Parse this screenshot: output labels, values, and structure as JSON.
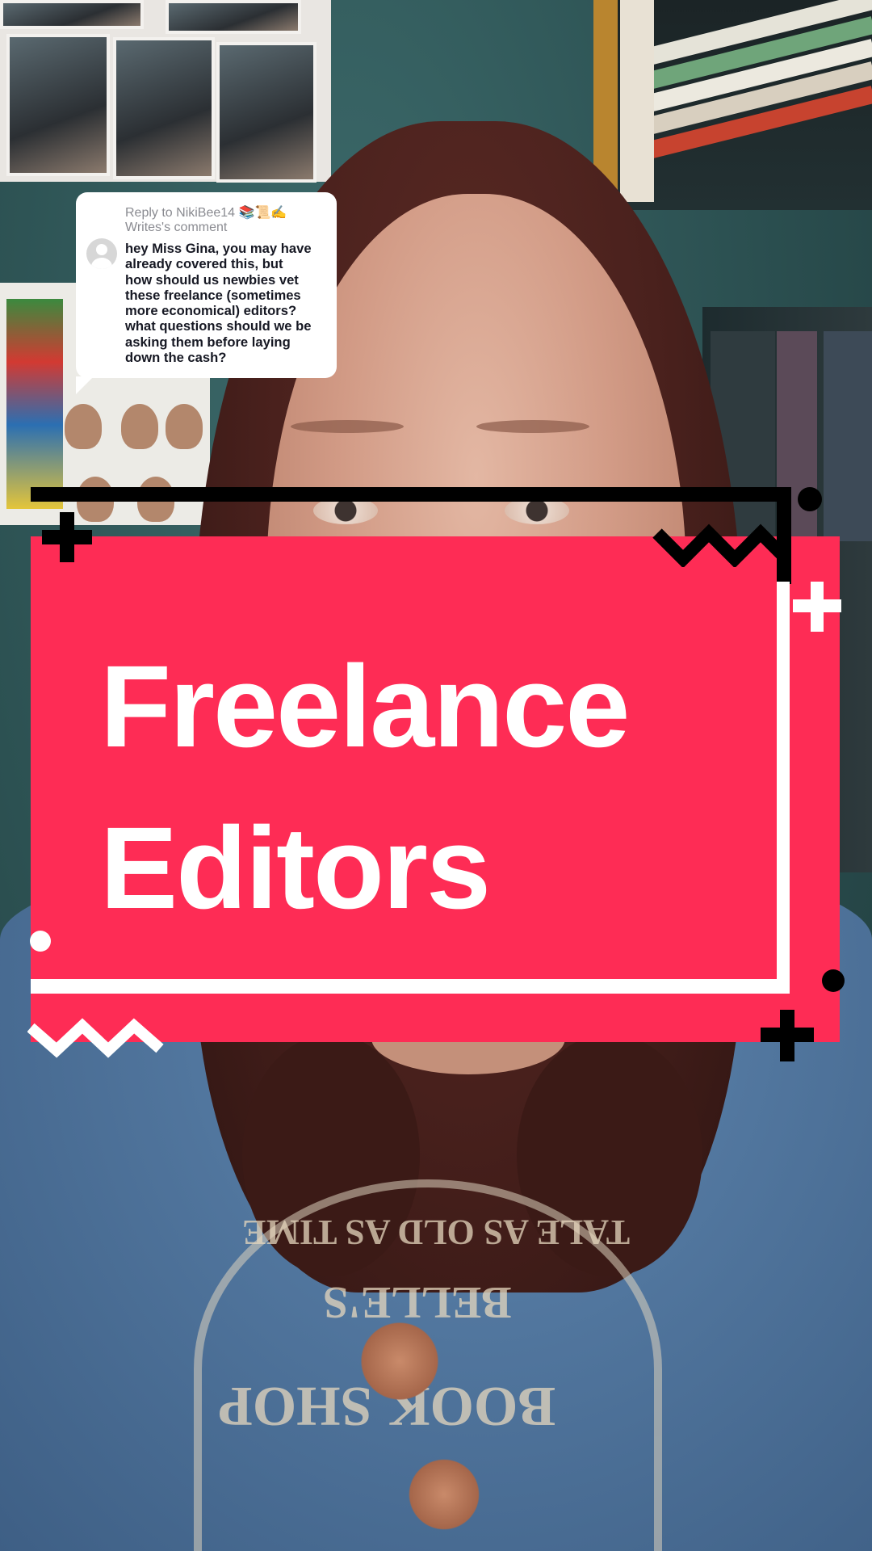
{
  "reply": {
    "header_line1": "Reply to NikiBee14 📚📜✍️",
    "header_line2": "Writes's comment",
    "comment_lines": [
      "hey Miss Gina, you may have",
      "already covered this, but",
      "how should us newbies vet",
      "these freelance (sometimes",
      "more economical) editors?",
      "what questions should we be",
      "asking them before laying",
      "down the cash?"
    ]
  },
  "title_card": {
    "line1": "Freelance",
    "line2": "Editors"
  },
  "background_text": {
    "shirt_arc": "TALE AS OLD AS TIME",
    "shirt_belle": "BELLE'S",
    "shirt_bookshop": "BOOK SHOP"
  },
  "colors": {
    "card_red": "#fe2c55",
    "bubble_white": "#ffffff",
    "comment_text": "#161823",
    "meta_text": "#8a8b91"
  },
  "icons": {
    "avatar": "default-user-avatar-icon",
    "decor_plus": "plus-icon",
    "decor_zigzag": "zigzag-icon",
    "decor_dot": "dot-icon"
  }
}
